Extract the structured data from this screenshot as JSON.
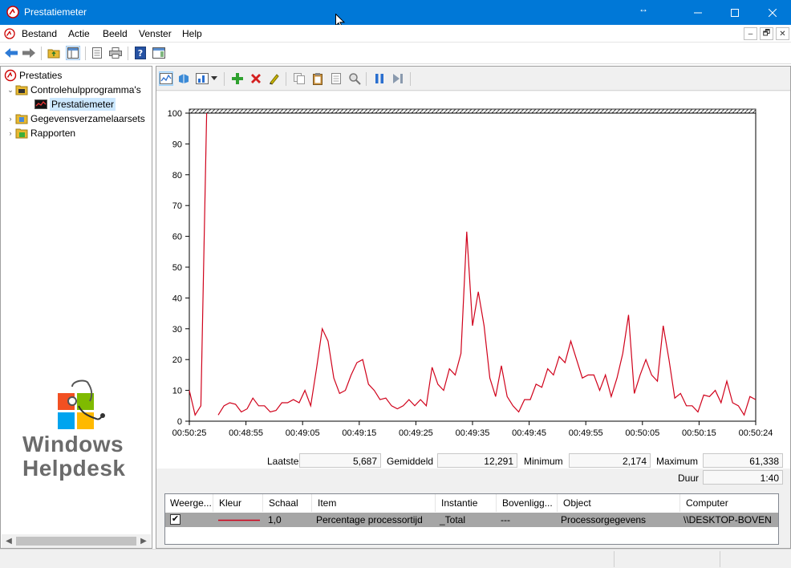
{
  "window": {
    "title": "Prestatiemeter",
    "controls": {
      "minimize": "—",
      "maximize": "☐",
      "close": "✕"
    },
    "resize_glyph": "↔"
  },
  "menu": {
    "items": [
      "Bestand",
      "Actie",
      "Beeld",
      "Venster",
      "Help"
    ],
    "mdi_controls": [
      "–",
      "🗗",
      "✕"
    ]
  },
  "tree": {
    "root": "Prestaties",
    "items": [
      {
        "label": "Controlehulpprogramma's",
        "expanded": true
      },
      {
        "label": "Prestatiemeter",
        "selected": true
      },
      {
        "label": "Gegevensverzamelaarsets",
        "expanded": false
      },
      {
        "label": "Rapporten",
        "expanded": false
      }
    ]
  },
  "logo": {
    "line1": "Windows",
    "line2": "Helpdesk"
  },
  "stats": {
    "laatste_label": "Laatste",
    "laatste_value": "5,687",
    "gemiddeld_label": "Gemiddeld",
    "gemiddeld_value": "12,291",
    "minimum_label": "Minimum",
    "minimum_value": "2,174",
    "maximum_label": "Maximum",
    "maximum_value": "61,338",
    "duur_label": "Duur",
    "duur_value": "1:40"
  },
  "table": {
    "headers": [
      "Weerge...",
      "Kleur",
      "Schaal",
      "Item",
      "Instantie",
      "Bovenligg...",
      "Object",
      "Computer"
    ],
    "row": {
      "checked": "✔",
      "schaal": "1,0",
      "item": "Percentage processortijd",
      "instantie": "_Total",
      "bovenliggend": "---",
      "object": "Processorgegevens",
      "computer": "\\\\DESKTOP-BOVEN"
    }
  },
  "colors": {
    "accent": "#0078d7",
    "series": "#d0021b"
  },
  "chart_data": {
    "type": "line",
    "ylim": [
      0,
      100
    ],
    "yticks": [
      0,
      10,
      20,
      30,
      40,
      50,
      60,
      70,
      80,
      90,
      100
    ],
    "xticks": [
      "00:50:25",
      "00:48:55",
      "00:49:05",
      "00:49:15",
      "00:49:25",
      "00:49:35",
      "00:49:45",
      "00:49:55",
      "00:50:05",
      "00:50:15",
      "00:50:24"
    ],
    "grid": false,
    "legend": "none",
    "series": [
      {
        "segment_a": [
          10,
          2,
          5,
          100
        ],
        "segment_b": [
          2,
          5,
          6,
          5.5,
          3,
          4,
          7.5,
          5,
          5,
          3,
          3.5,
          6,
          6,
          7,
          6,
          10,
          5,
          17,
          30,
          26,
          14,
          9,
          10,
          15,
          19,
          20,
          12,
          10,
          7,
          7.5,
          5,
          4,
          5,
          7,
          5,
          7,
          5,
          17.5,
          12,
          10,
          17,
          15,
          22,
          61.5,
          31,
          42,
          31,
          14,
          8,
          18,
          8,
          5,
          3,
          7,
          7,
          12,
          11,
          17,
          15,
          21,
          19,
          26,
          20,
          14,
          15,
          15,
          10,
          15,
          8,
          14,
          22,
          34.5,
          9,
          15,
          20,
          15,
          13,
          31,
          20,
          7.5,
          9,
          5,
          5,
          3,
          8.5,
          8,
          10,
          6,
          13,
          6,
          5,
          2,
          8,
          7
        ]
      }
    ]
  }
}
